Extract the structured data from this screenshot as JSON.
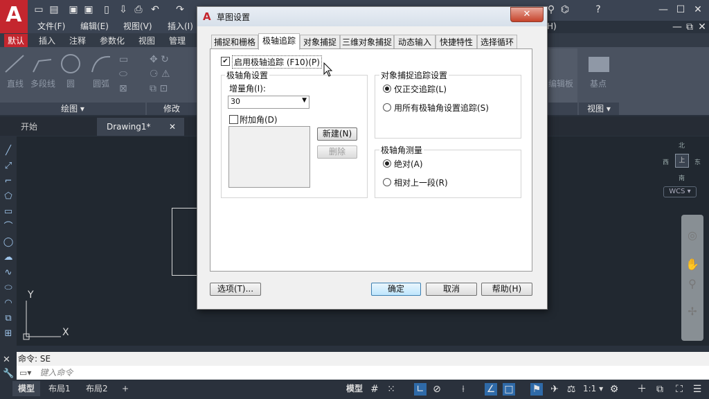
{
  "app": {
    "logo": "A"
  },
  "window_controls": {
    "minimize": "—",
    "maximize": "☐",
    "close": "✕",
    "doc_minimize": "—",
    "doc_restore": "⧉",
    "doc_close": "✕"
  },
  "menu": [
    "文件(F)",
    "编辑(E)",
    "视图(V)",
    "插入(I)"
  ],
  "menu_right_fragment": "H)",
  "ribbon_tabs": [
    "默认",
    "插入",
    "注释",
    "参数化",
    "视图",
    "管理"
  ],
  "ribbon": {
    "draw_tools": [
      "直线",
      "多段线",
      "圆",
      "圆弧"
    ],
    "draw_panel": "绘图 ▾",
    "modify_panel": "修改",
    "right_tools": [
      "编辑板",
      "基点"
    ],
    "view_panel": "视图 ▾"
  },
  "doc_tabs": {
    "start": "开始",
    "drawing": "Drawing1*",
    "close": "✕"
  },
  "viewcube": {
    "north": "北",
    "west": "西",
    "east": "东",
    "south": "南",
    "center": "上",
    "wcs": "WCS ▾"
  },
  "ucs": {
    "x": "X",
    "y": "Y"
  },
  "command": {
    "history": "命令: SE",
    "placeholder": "键入命令"
  },
  "status": {
    "model": "模型",
    "layout1": "布局1",
    "layout2": "布局2",
    "add": "+",
    "model_btn": "模型",
    "scale": "1:1 ▾"
  },
  "dialog": {
    "title": "草图设置",
    "tabs": [
      "捕捉和栅格",
      "极轴追踪",
      "对象捕捉",
      "三维对象捕捉",
      "动态输入",
      "快捷特性",
      "选择循环"
    ],
    "active_tab": "极轴追踪",
    "enable_polar": "启用极轴追踪 (F10)(P)",
    "polar_settings": {
      "title": "极轴角设置",
      "increment_label": "增量角(I):",
      "increment_value": "30",
      "additional_label": "附加角(D)",
      "new_button": "新建(N)",
      "delete_button": "删除"
    },
    "snap_tracking": {
      "title": "对象捕捉追踪设置",
      "option1": "仅正交追踪(L)",
      "option2": "用所有极轴角设置追踪(S)"
    },
    "measurement": {
      "title": "极轴角测量",
      "option1": "绝对(A)",
      "option2": "相对上一段(R)"
    },
    "buttons": {
      "options": "选项(T)...",
      "ok": "确定",
      "cancel": "取消",
      "help": "帮助(H)"
    }
  }
}
